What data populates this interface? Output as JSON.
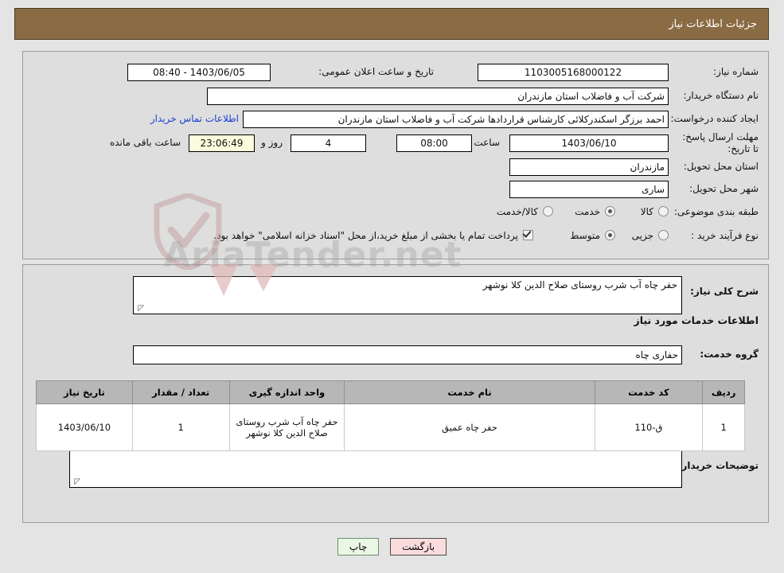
{
  "header": {
    "title": "جزئیات اطلاعات نیاز",
    "bar_color": "#8b6b43"
  },
  "watermark": {
    "text": "AriaTender.net"
  },
  "fields": {
    "need_number_label": "شماره نیاز:",
    "need_number_value": "1103005168000122",
    "announce_label": "تاریخ و ساعت اعلان عمومی:",
    "announce_value": "08:40 - 1403/06/05",
    "buyer_org_label": "نام دستگاه خریدار:",
    "buyer_org_value": "شرکت آب و فاضلاب استان مازندران",
    "creator_label": "ایجاد کننده درخواست:",
    "creator_value": "احمد برزگر اسکندرکلائی کارشناس قراردادها شرکت آب و فاضلاب استان مازندران",
    "contact_link": "اطلاعات تماس خریدار",
    "deadline_label": "مهلت ارسال پاسخ: تا تاریخ:",
    "deadline_date": "1403/06/10",
    "hour_label": "ساعت",
    "deadline_time": "08:00",
    "days_value": "4",
    "days_label": "روز و",
    "countdown_value": "23:06:49",
    "remaining_label": "ساعت باقی مانده",
    "province_label": "استان محل تحویل:",
    "province_value": "مازندران",
    "city_label": "شهر محل تحویل:",
    "city_value": "ساری",
    "category_label": "طبقه بندی موضوعی:",
    "category_options": [
      "کالا",
      "خدمت",
      "کالا/خدمت"
    ],
    "category_selected": "خدمت",
    "process_label": "نوع فرآیند خرید :",
    "process_options": [
      "جزیی",
      "متوسط"
    ],
    "process_selected": "متوسط",
    "treasury_note": "پرداخت تمام یا بخشی از مبلغ خرید،از محل \"اسناد خزانه اسلامی\" خواهد بود.",
    "treasury_checked": true
  },
  "description": {
    "need_summary_label": "شرح کلی نیاز:",
    "need_summary_value": "حفر چاه آب شرب روستای صلاح الدین کلا نوشهر",
    "services_heading": "اطلاعات خدمات مورد نیاز",
    "service_group_label": "گروه خدمت:",
    "service_group_value": "حفاری چاه",
    "buyer_notes_label": "توضیحات خریدار:",
    "buyer_notes_value": ""
  },
  "table": {
    "headers": [
      "ردیف",
      "کد خدمت",
      "نام خدمت",
      "واحد اندازه گیری",
      "تعداد / مقدار",
      "تاریخ نیاز"
    ],
    "rows": [
      {
        "row": "1",
        "service_code": "ق-110",
        "service_name": "حفر چاه عمیق",
        "unit": "حفر چاه آب شرب روستای صلاح الدین کلا نوشهر",
        "quantity": "1",
        "need_date": "1403/06/10"
      }
    ]
  },
  "buttons": {
    "back": "بازگشت",
    "print": "چاپ"
  }
}
